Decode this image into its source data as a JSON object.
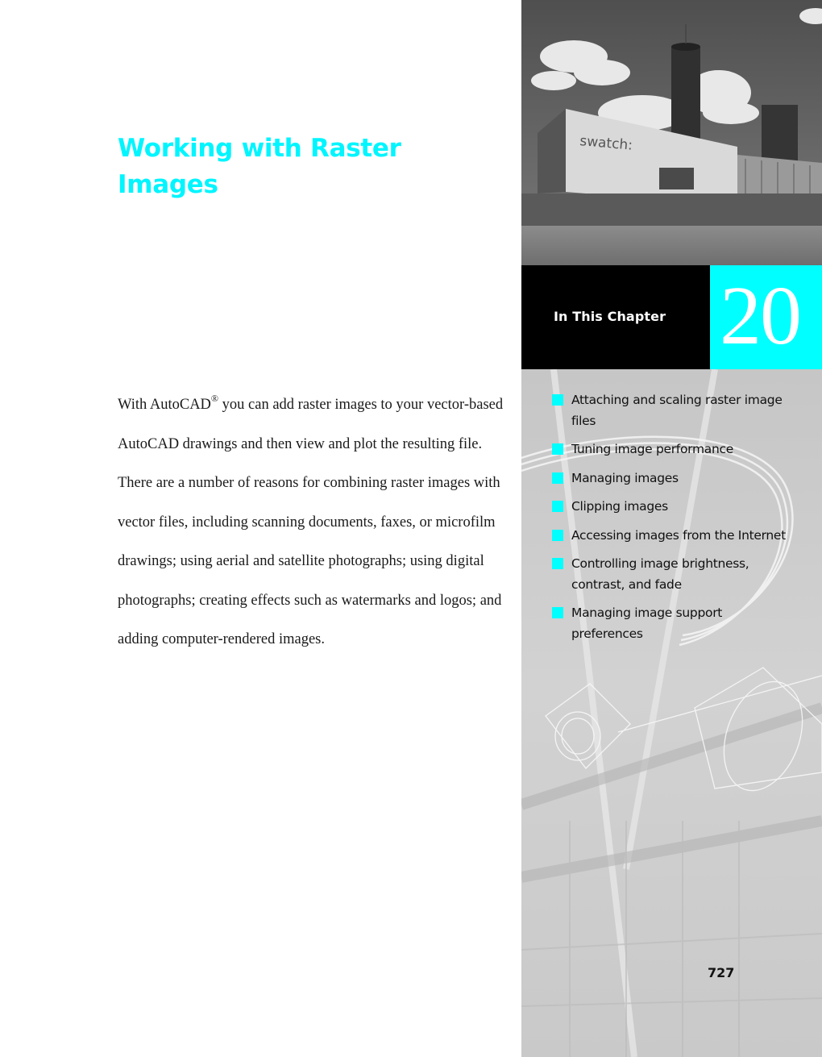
{
  "chapter": {
    "title": "Working with Raster Images",
    "title_line1": "Working with Raster",
    "title_line2": "Images",
    "number": "20",
    "in_this_chapter_label": "In This Chapter",
    "page_number": "727"
  },
  "intro": {
    "pre_trademark": "With AutoCAD",
    "trademark_symbol": "®",
    "post_trademark": " you can add raster images to your vector-based AutoCAD drawings and then view and plot the resulting file. There are a number of reasons for combining raster images with vector files, including scanning documents, faxes, or microfilm drawings; using aerial and satellite photographs; using digital photographs; creating effects such as watermarks and logos; and adding computer-rendered images."
  },
  "topics": [
    "Attaching and scaling raster image files",
    "Tuning image performance",
    "Managing images",
    "Clipping images",
    "Accessing images from the Internet",
    "Controlling image brightness, contrast, and fade",
    "Managing image support preferences"
  ],
  "photo": {
    "sign_text": "swatch:",
    "description": "black-and-white photo of a modern building with a cylindrical tower"
  },
  "colors": {
    "accent_cyan": "#00ffff",
    "title_cyan": "#00f5ff",
    "black": "#000000",
    "sidebar_gray": "#c8c8c8"
  }
}
